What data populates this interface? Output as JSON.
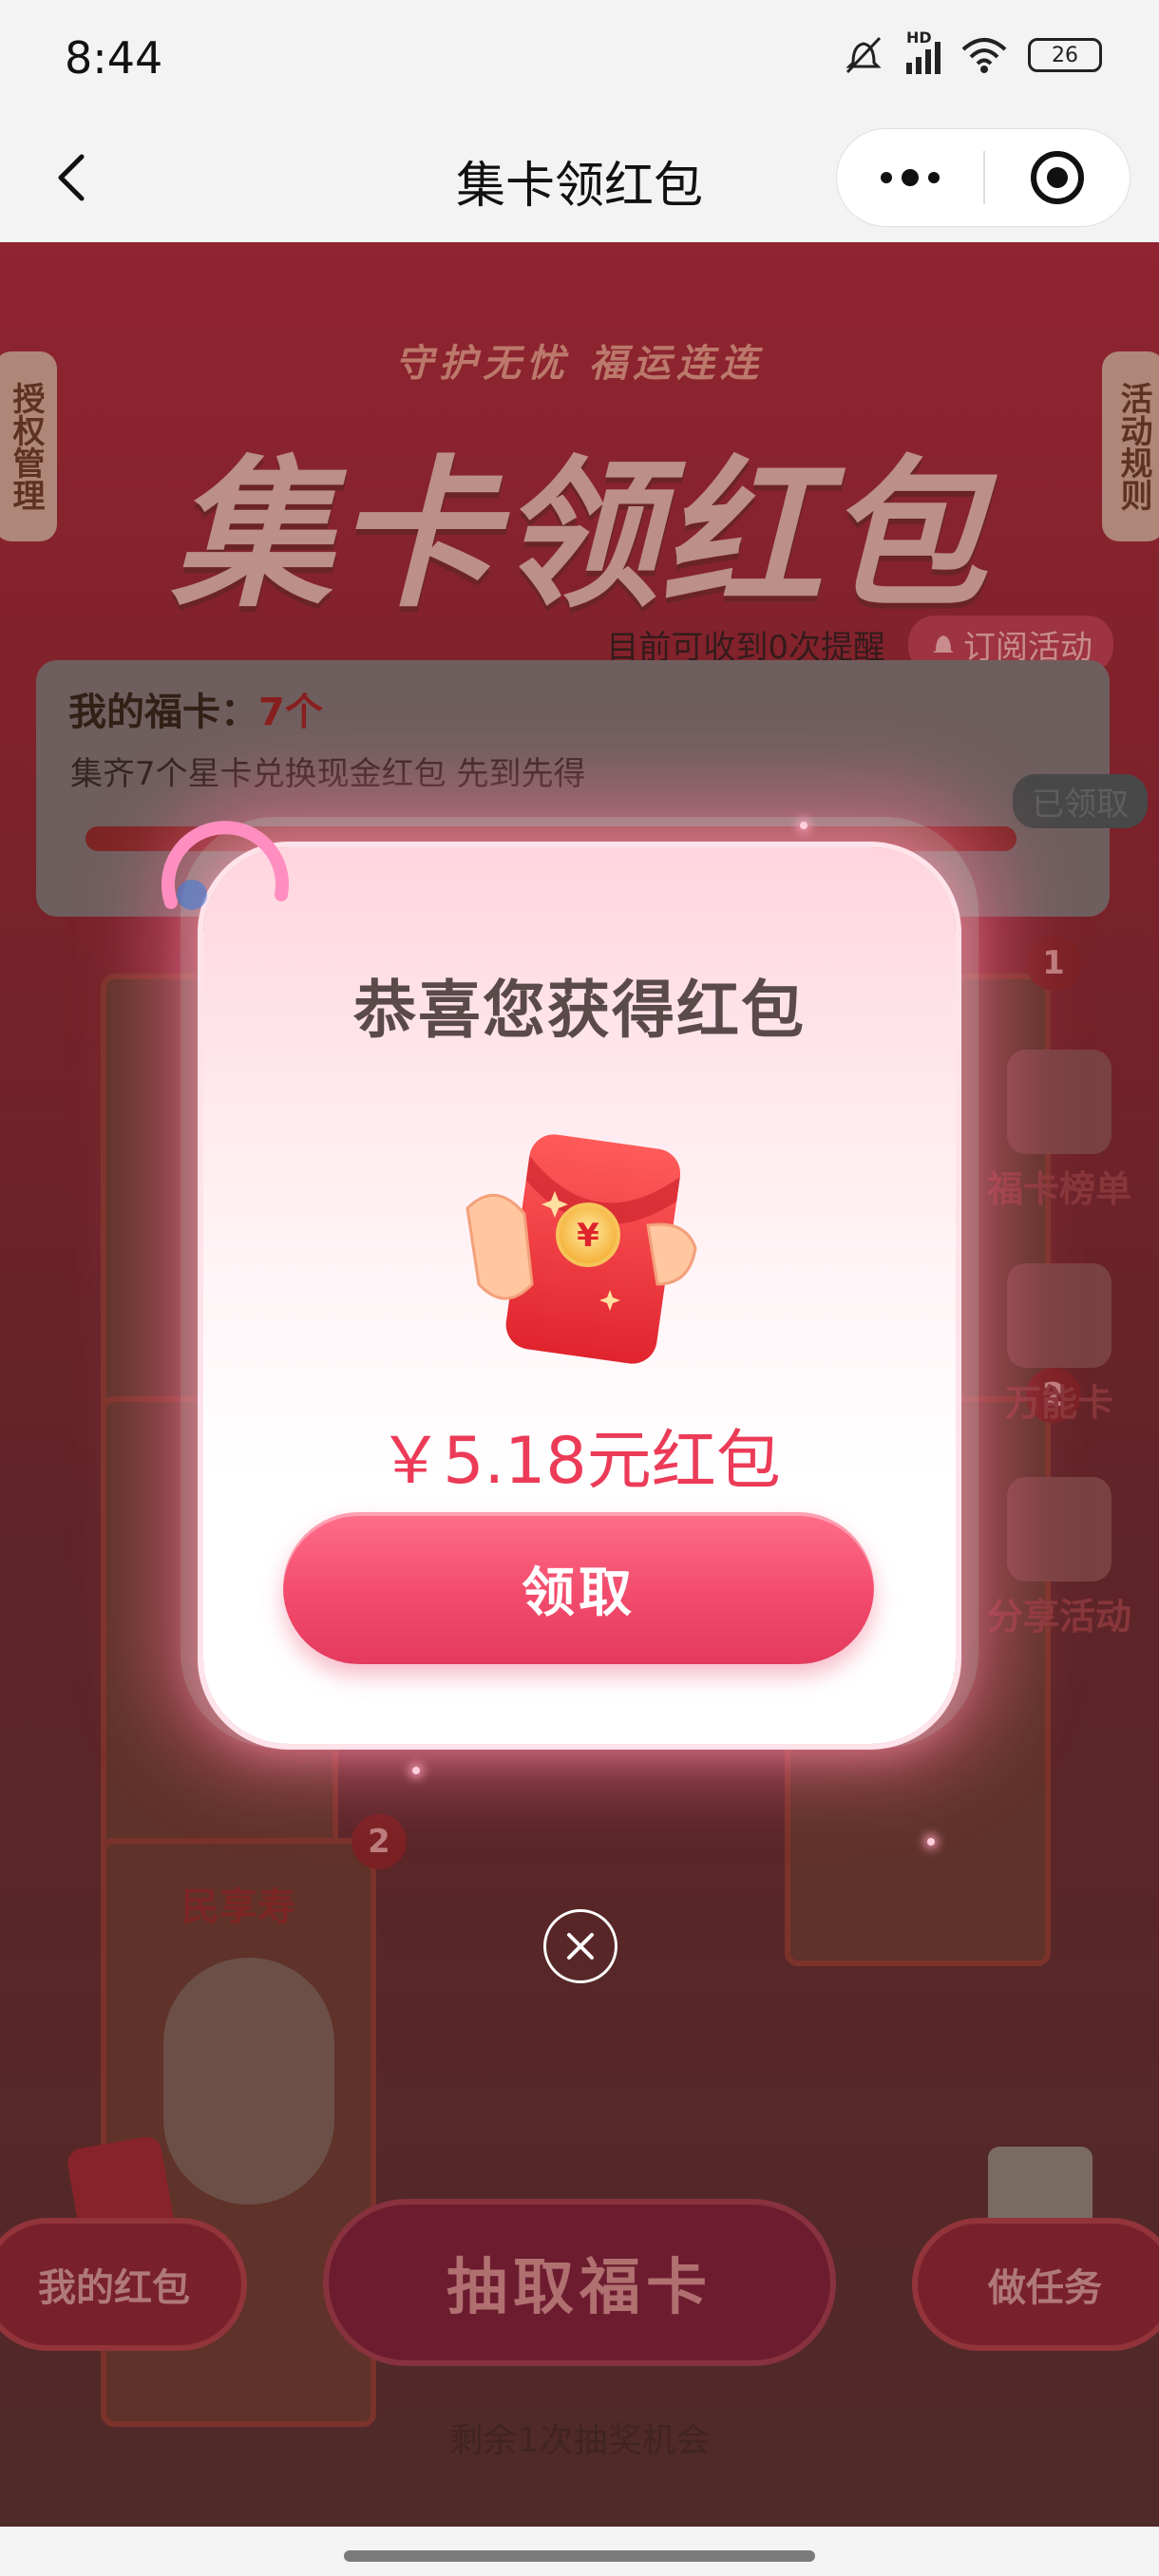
{
  "status_bar": {
    "time": "8:44",
    "battery": "26",
    "network": "HD"
  },
  "nav": {
    "title": "集卡领红包"
  },
  "page": {
    "slogan": "守护无忧 福运连连",
    "hero_title": "集卡领红包",
    "left_tab": "授权管理",
    "right_tab": "活动规则",
    "reminder": "目前可收到0次提醒",
    "subscribe_label": "订阅活动",
    "my_cards_label": "我的福卡：",
    "my_cards_count": "7个",
    "collect_desc": "集齐7个星卡兑换现金红包 先到先得",
    "received_badge": "已领取",
    "card_badge_1": "1",
    "card_badge_2": "2",
    "card_badge_3": "2",
    "card5_label": "民享寿",
    "side_widgets": [
      "福卡榜单",
      "万能卡",
      "分享活动"
    ],
    "my_redpacket_button": "我的红包",
    "draw_button": "抽取福卡",
    "tasks_button": "做任务",
    "remaining_chances": "剩余1次抽奖机会"
  },
  "dialog": {
    "title": "恭喜您获得红包",
    "amount": "￥5.18元红包",
    "claim_button": "领取"
  },
  "colors": {
    "accent": "#f24b6c",
    "amount_text": "#ec3b57",
    "page_bg": "#8e2630"
  }
}
